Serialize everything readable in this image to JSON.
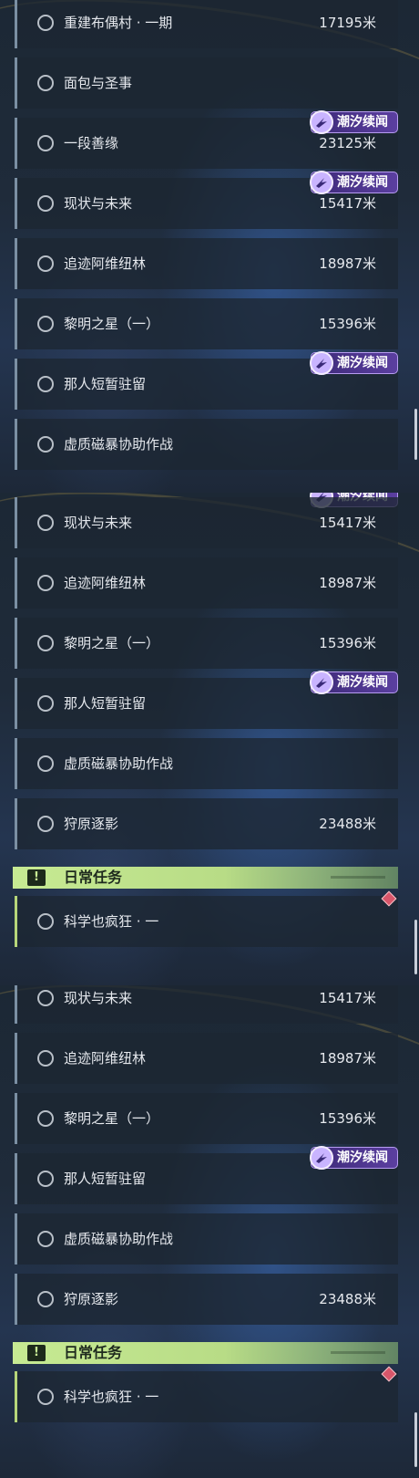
{
  "panels": [
    {
      "rows": [
        {
          "name": "重建布偶村 · 一期",
          "distance": "17195米"
        },
        {
          "name": "面包与圣事",
          "distance": ""
        },
        {
          "name": "一段善缘",
          "distance": "23125米"
        },
        {
          "name": "现状与未来",
          "distance": "15417米"
        },
        {
          "name": "追迹阿维纽林",
          "distance": "18987米"
        },
        {
          "name": "黎明之星（一）",
          "distance": "15396米"
        },
        {
          "name": "那人短暂驻留",
          "distance": ""
        },
        {
          "name": "虚质磁暴协助作战",
          "distance": ""
        }
      ],
      "tags": [
        "潮汐续闻",
        "潮汐续闻",
        "潮汐续闻"
      ]
    },
    {
      "rows": [
        {
          "name": "现状与未来",
          "distance": "15417米"
        },
        {
          "name": "追迹阿维纽林",
          "distance": "18987米"
        },
        {
          "name": "黎明之星（一）",
          "distance": "15396米"
        },
        {
          "name": "那人短暂驻留",
          "distance": ""
        },
        {
          "name": "虚质磁暴协助作战",
          "distance": ""
        },
        {
          "name": "狩原逐影",
          "distance": "23488米"
        }
      ],
      "tags": [
        "潮汐续闻",
        "潮汐续闻"
      ],
      "section_header": "日常任务",
      "daily_rows": [
        {
          "name": "科学也疯狂 · 一",
          "distance": ""
        }
      ]
    },
    {
      "rows": [
        {
          "name": "现状与未来",
          "distance": "15417米"
        },
        {
          "name": "追迹阿维纽林",
          "distance": "18987米"
        },
        {
          "name": "黎明之星（一）",
          "distance": "15396米"
        },
        {
          "name": "那人短暂驻留",
          "distance": ""
        },
        {
          "name": "虚质磁暴协助作战",
          "distance": ""
        },
        {
          "name": "狩原逐影",
          "distance": "23488米"
        }
      ],
      "tags": [
        "潮汐续闻"
      ],
      "section_header": "日常任务",
      "daily_rows": [
        {
          "name": "科学也疯狂 · 一",
          "distance": ""
        }
      ]
    }
  ],
  "icons": {
    "quest_status": "circle-outline-icon",
    "tag_badge": "tide-story-badge-icon",
    "header_icon": "exclamation-icon",
    "tracked_marker": "red-diamond-icon"
  },
  "colors": {
    "tag_purple": "#5b3fa0",
    "header_green": "#c7ea93",
    "row_bg": "#1c2632",
    "marker_red": "#d8566a"
  }
}
